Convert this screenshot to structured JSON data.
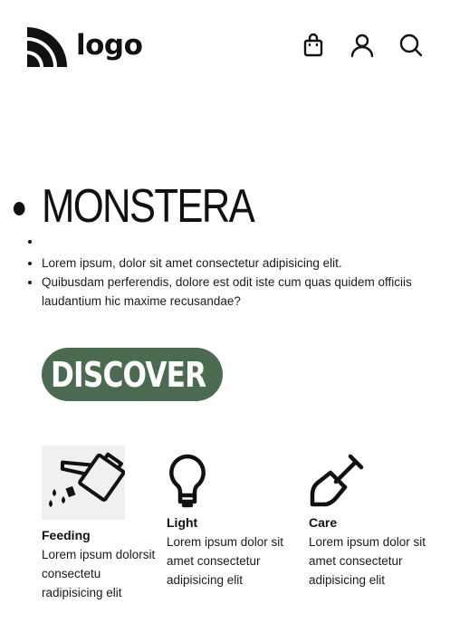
{
  "header": {
    "logo_text": "logo",
    "icons": [
      "shopping-bag-icon",
      "user-icon",
      "search-icon"
    ]
  },
  "hero": {
    "title": "MONSTERA",
    "items": [
      "Lorem ipsum, dolor sit amet consectetur adipisicing elit.",
      "Quibusdam perferendis, dolore est odit iste cum quas quidem officiis laudantium hic maxime recusandae?"
    ],
    "cta_label": "DISCOVER",
    "cta_color": "#4a6b4f"
  },
  "features": [
    {
      "icon": "watering-can-icon",
      "title": "Feeding",
      "desc": "Lorem ipsum dolorsit consectetu radipisicing elit"
    },
    {
      "icon": "light-bulb-icon",
      "title": "Light",
      "desc": "Lorem ipsum dolor sit amet consectetur adipisicing elit"
    },
    {
      "icon": "shovel-icon",
      "title": "Care",
      "desc": "Lorem ipsum dolor sit amet consectetur adipisicing elit"
    }
  ]
}
